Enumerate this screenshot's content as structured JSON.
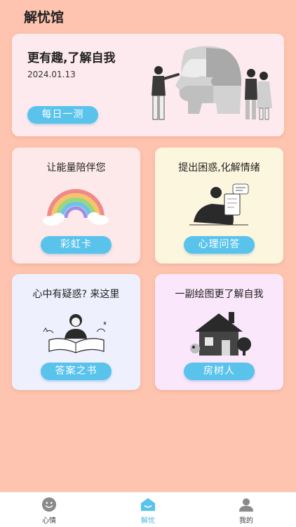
{
  "header": {
    "title": "解忧馆"
  },
  "hero": {
    "title": "更有趣,了解自我",
    "date": "2024.01.13",
    "button": "每日一测"
  },
  "tiles": [
    {
      "title": "让能量陪伴您",
      "button": "彩虹卡",
      "icon": "rainbow-illustration"
    },
    {
      "title": "提出困惑,化解情绪",
      "button": "心理问答",
      "icon": "person-reading-illustration"
    },
    {
      "title": "心中有疑惑? 来这里",
      "button": "答案之书",
      "icon": "open-book-illustration"
    },
    {
      "title": "一副绘图更了解自我",
      "button": "房树人",
      "icon": "house-tree-illustration"
    }
  ],
  "tabbar": {
    "items": [
      {
        "label": "心情",
        "icon": "smiley-icon"
      },
      {
        "label": "解忧",
        "icon": "house-icon",
        "active": true
      },
      {
        "label": "我的",
        "icon": "user-icon"
      }
    ]
  },
  "colors": {
    "background": "#fec4af",
    "accent": "#59c3ec"
  }
}
